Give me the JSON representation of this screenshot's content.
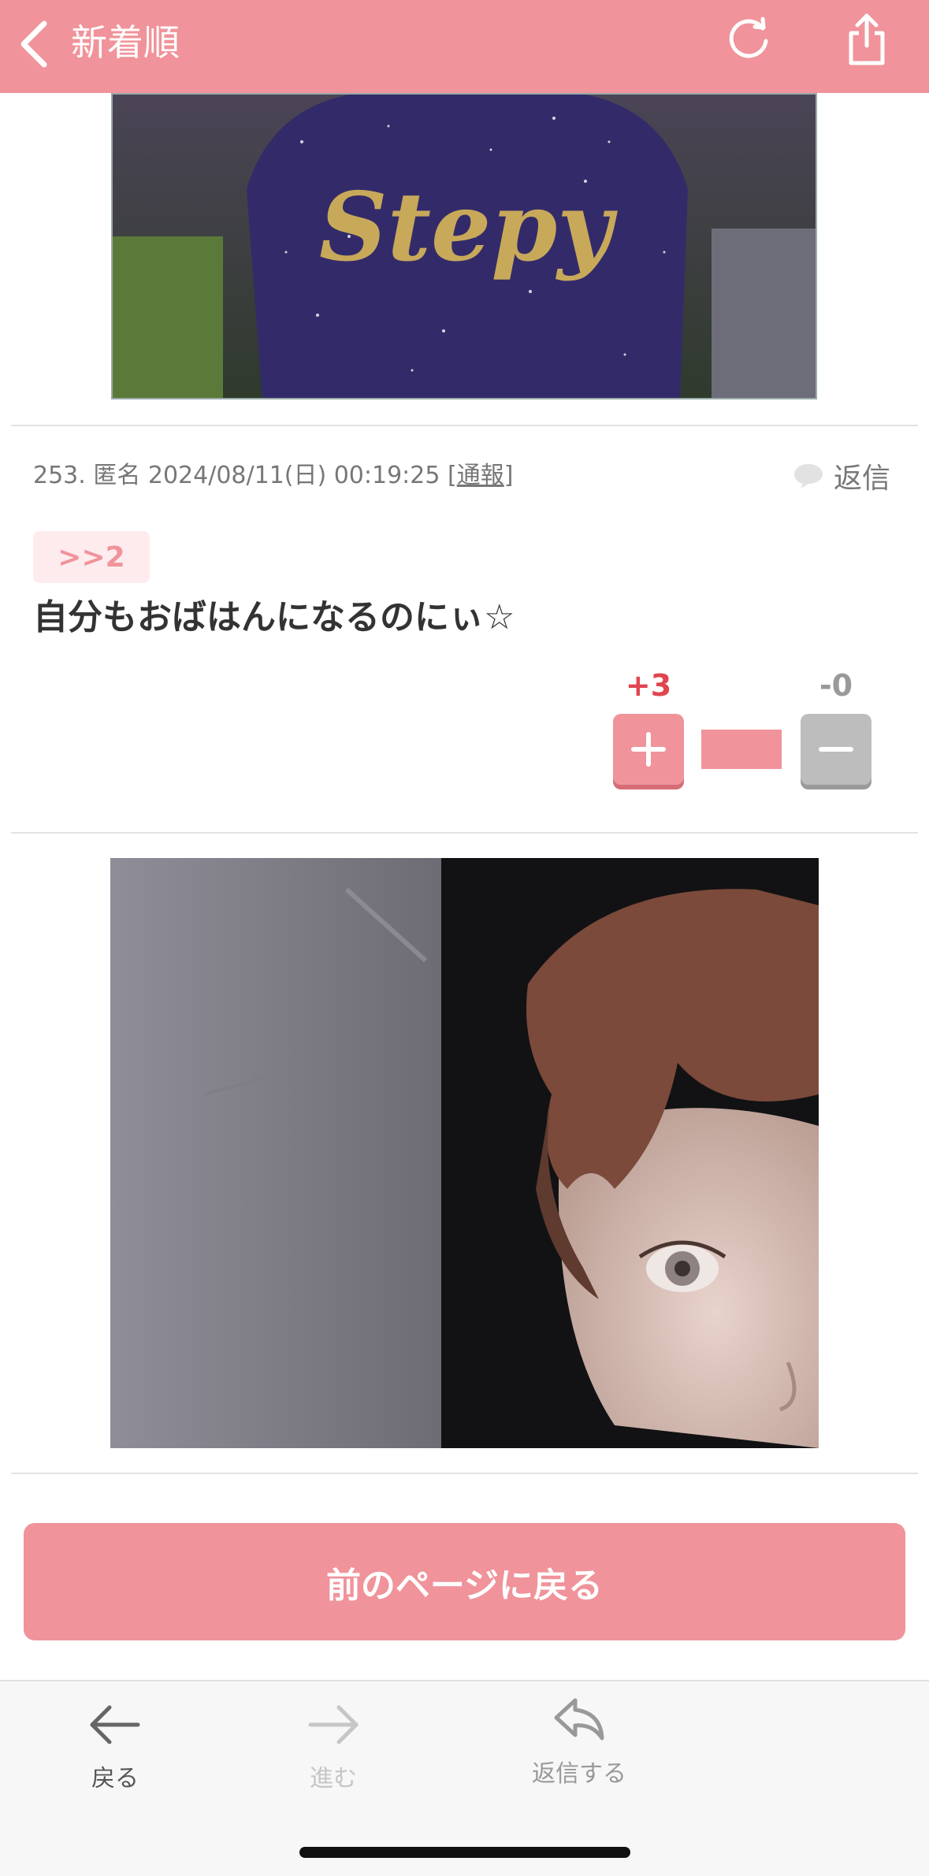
{
  "header": {
    "title": "新着順"
  },
  "comment": {
    "meta_prefix": "253. 匿名 2024/08/11(日) 00:19:25 [",
    "report_label": "通報",
    "meta_suffix": "]",
    "reply_label": "返信",
    "anchor": ">>2",
    "body": "自分もおばはんになるのにぃ☆",
    "plus_count": "+3",
    "minus_count": "-0",
    "vote_ratio": 1.0
  },
  "image1": {
    "logo_text": "Stepy"
  },
  "prev_page_label": "前のページに戻る",
  "toolbar": {
    "back_label": "戻る",
    "forward_label": "進む",
    "reply_label": "返信する"
  },
  "colors": {
    "accent": "#f0939a",
    "plus": "#e0454f",
    "minus": "#999999"
  }
}
